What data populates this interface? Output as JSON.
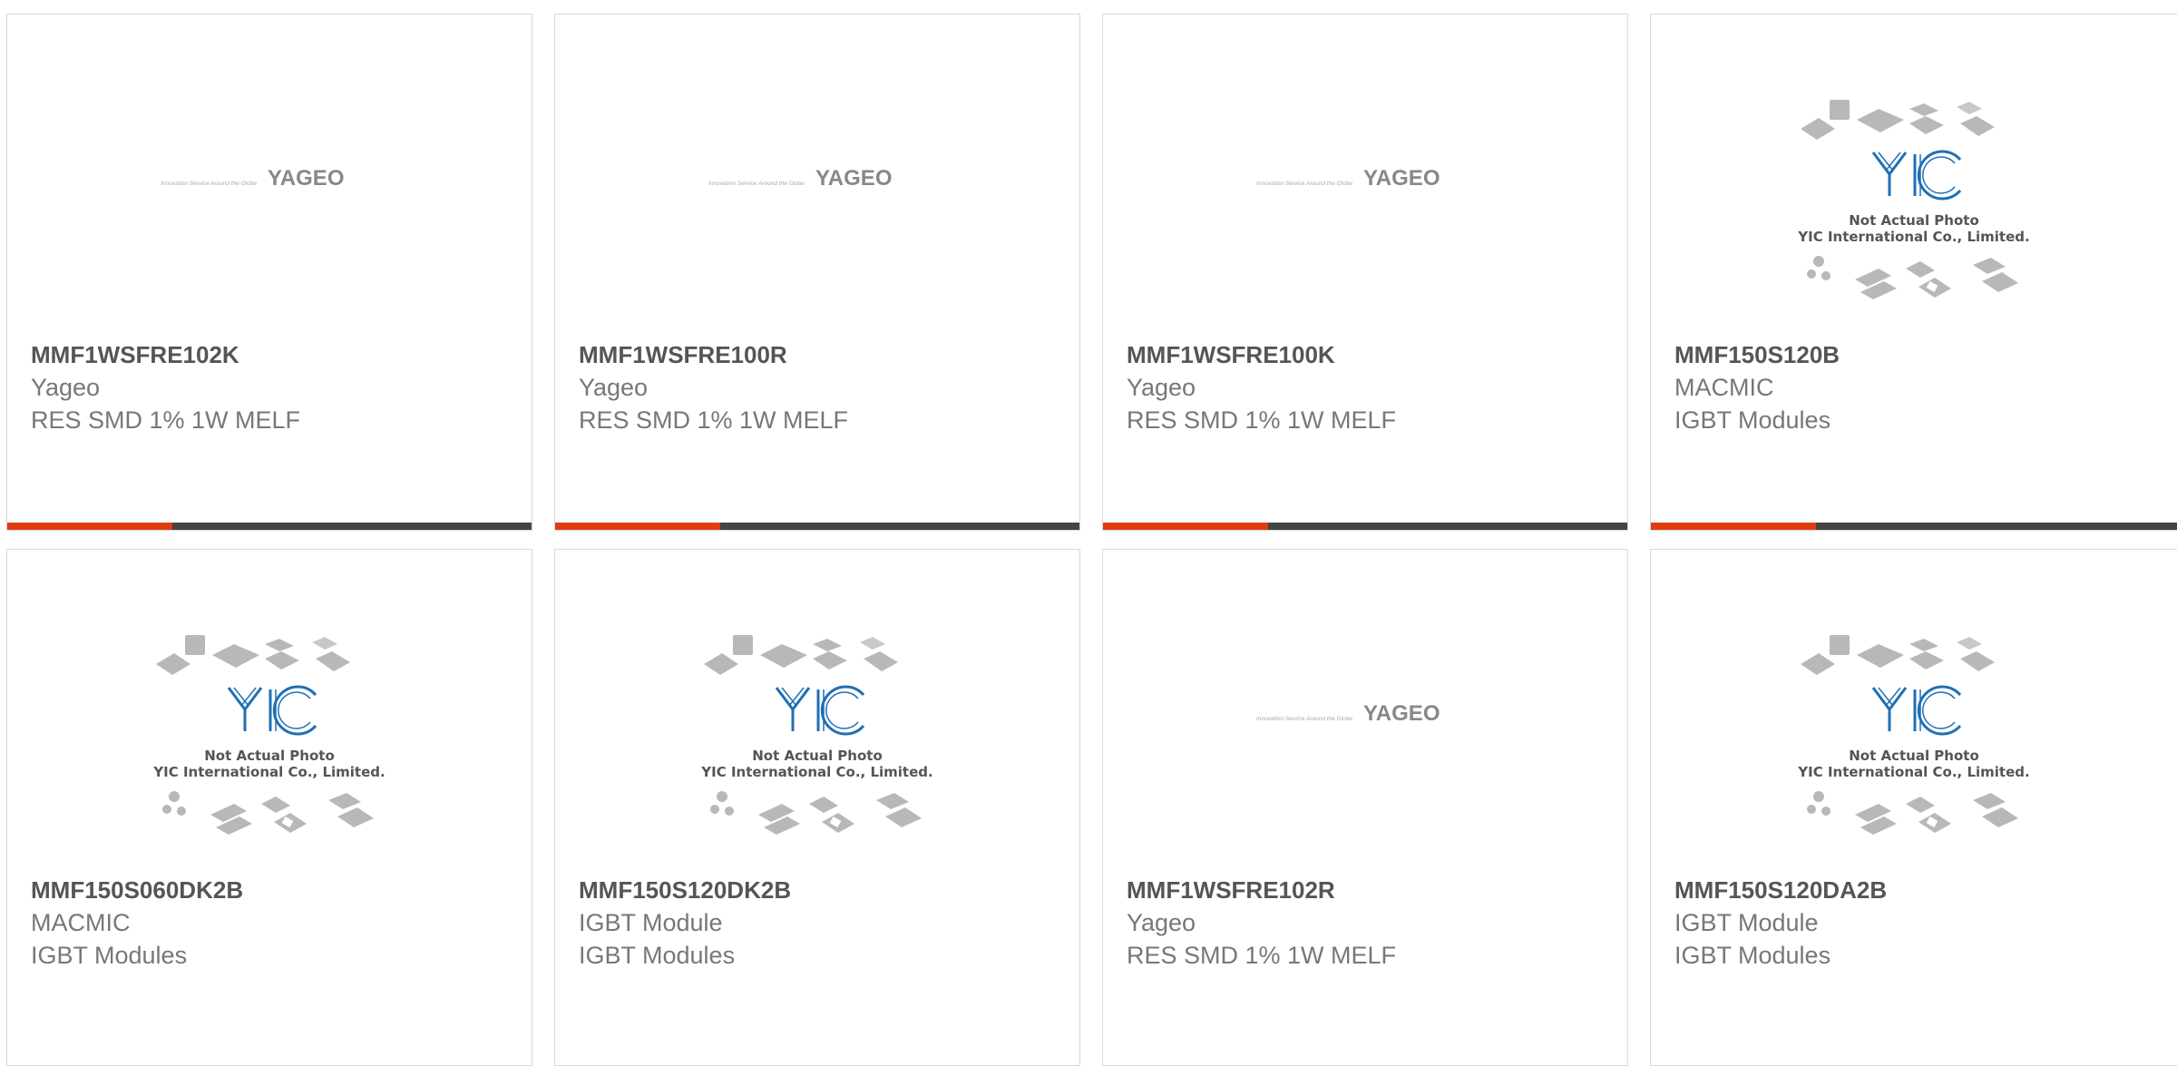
{
  "colors": {
    "accent": "#e03c10",
    "bar_dark": "#444444",
    "yic_blue": "#1f6fb5"
  },
  "logos": {
    "yageo": {
      "tagline": "Innovation Service Around the Globe",
      "wordmark": "YAGEO"
    },
    "yic": {
      "line1": "Not Actual Photo",
      "line2": "YIC International Co., Limited."
    }
  },
  "products": [
    {
      "part": "MMF1WSFRE102K",
      "manufacturer": "Yageo",
      "description": "RES SMD 1% 1W MELF",
      "logo": "yageo"
    },
    {
      "part": "MMF1WSFRE100R",
      "manufacturer": "Yageo",
      "description": "RES SMD 1% 1W MELF",
      "logo": "yageo"
    },
    {
      "part": "MMF1WSFRE100K",
      "manufacturer": "Yageo",
      "description": "RES SMD 1% 1W MELF",
      "logo": "yageo"
    },
    {
      "part": "MMF150S120B",
      "manufacturer": "MACMIC",
      "description": "IGBT Modules",
      "logo": "yic"
    },
    {
      "part": "MMF150S060DK2B",
      "manufacturer": "MACMIC",
      "description": "IGBT Modules",
      "logo": "yic"
    },
    {
      "part": "MMF150S120DK2B",
      "manufacturer": "IGBT Module",
      "description": "IGBT Modules",
      "logo": "yic"
    },
    {
      "part": "MMF1WSFRE102R",
      "manufacturer": "Yageo",
      "description": "RES SMD 1% 1W MELF",
      "logo": "yageo"
    },
    {
      "part": "MMF150S120DA2B",
      "manufacturer": "IGBT Module",
      "description": "IGBT Modules",
      "logo": "yic"
    }
  ]
}
